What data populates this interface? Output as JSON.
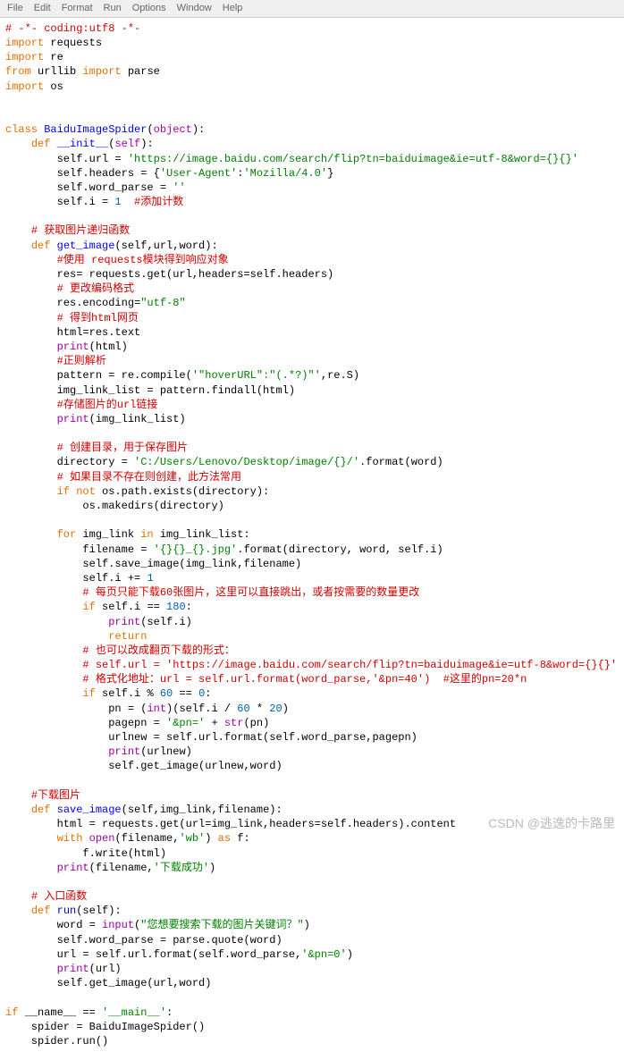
{
  "menu": [
    "File",
    "Edit",
    "Format",
    "Run",
    "Options",
    "Window",
    "Help"
  ],
  "lines": [
    [
      [
        "comment-red",
        "# -*- coding:utf8 -*-"
      ]
    ],
    [
      [
        "kw-orange",
        "import"
      ],
      [
        "txt",
        " requests"
      ]
    ],
    [
      [
        "kw-orange",
        "import"
      ],
      [
        "txt",
        " re"
      ]
    ],
    [
      [
        "kw-orange",
        "from"
      ],
      [
        "txt",
        " urllib "
      ],
      [
        "kw-orange",
        "import"
      ],
      [
        "txt",
        " parse"
      ]
    ],
    [
      [
        "kw-orange",
        "import"
      ],
      [
        "txt",
        " os"
      ]
    ],
    [
      [
        "txt",
        ""
      ]
    ],
    [
      [
        "txt",
        ""
      ]
    ],
    [
      [
        "kw-orange",
        "class"
      ],
      [
        "txt",
        " "
      ],
      [
        "kw-blue",
        "BaiduImageSpider"
      ],
      [
        "txt",
        "("
      ],
      [
        "bi-purple",
        "object"
      ],
      [
        "txt",
        "):"
      ]
    ],
    [
      [
        "txt",
        "    "
      ],
      [
        "kw-orange",
        "def"
      ],
      [
        "txt",
        " "
      ],
      [
        "kw-blue",
        "__init__"
      ],
      [
        "txt",
        "("
      ],
      [
        "bi-purple",
        "self"
      ],
      [
        "txt",
        "):"
      ]
    ],
    [
      [
        "txt",
        "        self.url = "
      ],
      [
        "str-green",
        "'https://image.baidu.com/search/flip?tn=baiduimage&ie=utf-8&word={}{}'"
      ]
    ],
    [
      [
        "txt",
        "        self.headers = {"
      ],
      [
        "str-green",
        "'User-Agent'"
      ],
      [
        "txt",
        ":"
      ],
      [
        "str-green",
        "'Mozilla/4.0'"
      ],
      [
        "txt",
        "}"
      ]
    ],
    [
      [
        "txt",
        "        self.word_parse = "
      ],
      [
        "str-green",
        "''"
      ],
      [
        "txt",
        ""
      ]
    ],
    [
      [
        "txt",
        "        self.i = "
      ],
      [
        "num",
        "1"
      ],
      [
        "txt",
        "  "
      ],
      [
        "comment-red",
        "#添加计数"
      ]
    ],
    [
      [
        "txt",
        ""
      ]
    ],
    [
      [
        "txt",
        "    "
      ],
      [
        "comment-red",
        "# 获取图片递归函数"
      ]
    ],
    [
      [
        "txt",
        "    "
      ],
      [
        "kw-orange",
        "def"
      ],
      [
        "txt",
        " "
      ],
      [
        "kw-blue",
        "get_image"
      ],
      [
        "txt",
        "(self,url,word):"
      ]
    ],
    [
      [
        "txt",
        "        "
      ],
      [
        "comment-red",
        "#使用 requests模块得到响应对象"
      ]
    ],
    [
      [
        "txt",
        "        res= requests.get(url,headers=self.headers)"
      ]
    ],
    [
      [
        "txt",
        "        "
      ],
      [
        "comment-red",
        "# 更改编码格式"
      ]
    ],
    [
      [
        "txt",
        "        res.encoding="
      ],
      [
        "str-green",
        "\"utf-8\""
      ]
    ],
    [
      [
        "txt",
        "        "
      ],
      [
        "comment-red",
        "# 得到html网页"
      ]
    ],
    [
      [
        "txt",
        "        html=res.text"
      ]
    ],
    [
      [
        "txt",
        "        "
      ],
      [
        "bi-purple",
        "print"
      ],
      [
        "txt",
        "(html)"
      ]
    ],
    [
      [
        "txt",
        "        "
      ],
      [
        "comment-red",
        "#正则解析"
      ]
    ],
    [
      [
        "txt",
        "        pattern = re.compile("
      ],
      [
        "str-green",
        "'\"hoverURL\":\"(.*?)\"'"
      ],
      [
        "txt",
        ",re.S)"
      ]
    ],
    [
      [
        "txt",
        "        img_link_list = pattern.findall(html)"
      ]
    ],
    [
      [
        "txt",
        "        "
      ],
      [
        "comment-red",
        "#存储图片的url链接"
      ]
    ],
    [
      [
        "txt",
        "        "
      ],
      [
        "bi-purple",
        "print"
      ],
      [
        "txt",
        "(img_link_list)"
      ]
    ],
    [
      [
        "txt",
        ""
      ]
    ],
    [
      [
        "txt",
        "        "
      ],
      [
        "comment-red",
        "# 创建目录，用于保存图片"
      ]
    ],
    [
      [
        "txt",
        "        directory = "
      ],
      [
        "str-green",
        "'C:/Users/Lenovo/Desktop/image/{}/'"
      ],
      [
        "txt",
        ".format(word)"
      ]
    ],
    [
      [
        "txt",
        "        "
      ],
      [
        "comment-red",
        "# 如果目录不存在则创建，此方法常用"
      ]
    ],
    [
      [
        "txt",
        "        "
      ],
      [
        "kw-orange",
        "if not"
      ],
      [
        "txt",
        " os.path.exists(directory):"
      ]
    ],
    [
      [
        "txt",
        "            os.makedirs(directory)"
      ]
    ],
    [
      [
        "txt",
        ""
      ]
    ],
    [
      [
        "txt",
        "        "
      ],
      [
        "kw-orange",
        "for"
      ],
      [
        "txt",
        " img_link "
      ],
      [
        "kw-orange",
        "in"
      ],
      [
        "txt",
        " img_link_list:"
      ]
    ],
    [
      [
        "txt",
        "            filename = "
      ],
      [
        "str-green",
        "'{}{}_{}.jpg'"
      ],
      [
        "txt",
        ".format(directory, word, self.i)"
      ]
    ],
    [
      [
        "txt",
        "            self.save_image(img_link,filename)"
      ]
    ],
    [
      [
        "txt",
        "            self.i += "
      ],
      [
        "num",
        "1"
      ]
    ],
    [
      [
        "txt",
        "            "
      ],
      [
        "comment-red",
        "# 每页只能下载60张图片，这里可以直接跳出，或者按需要的数量更改"
      ]
    ],
    [
      [
        "txt",
        "            "
      ],
      [
        "kw-orange",
        "if"
      ],
      [
        "txt",
        " self.i == "
      ],
      [
        "num",
        "180"
      ],
      [
        "txt",
        ":"
      ]
    ],
    [
      [
        "txt",
        "                "
      ],
      [
        "bi-purple",
        "print"
      ],
      [
        "txt",
        "(self.i)"
      ]
    ],
    [
      [
        "txt",
        "                "
      ],
      [
        "kw-orange",
        "return"
      ]
    ],
    [
      [
        "txt",
        "            "
      ],
      [
        "comment-red",
        "# 也可以改成翻页下载的形式："
      ]
    ],
    [
      [
        "txt",
        "            "
      ],
      [
        "comment-red",
        "# self.url = 'https://image.baidu.com/search/flip?tn=baiduimage&ie=utf-8&word={}{}'"
      ]
    ],
    [
      [
        "txt",
        "            "
      ],
      [
        "comment-red",
        "# 格式化地址：url = self.url.format(word_parse,'&pn=40')  #这里的pn=20*n"
      ]
    ],
    [
      [
        "txt",
        "            "
      ],
      [
        "kw-orange",
        "if"
      ],
      [
        "txt",
        " self.i % "
      ],
      [
        "num",
        "60"
      ],
      [
        "txt",
        " == "
      ],
      [
        "num",
        "0"
      ],
      [
        "txt",
        ":"
      ]
    ],
    [
      [
        "txt",
        "                pn = ("
      ],
      [
        "bi-purple",
        "int"
      ],
      [
        "txt",
        ")(self.i / "
      ],
      [
        "num",
        "60"
      ],
      [
        "txt",
        " * "
      ],
      [
        "num",
        "20"
      ],
      [
        "txt",
        ")"
      ]
    ],
    [
      [
        "txt",
        "                pagepn = "
      ],
      [
        "str-green",
        "'&pn='"
      ],
      [
        "txt",
        " + "
      ],
      [
        "bi-purple",
        "str"
      ],
      [
        "txt",
        "(pn)"
      ]
    ],
    [
      [
        "txt",
        "                urlnew = self.url.format(self.word_parse,pagepn)"
      ]
    ],
    [
      [
        "txt",
        "                "
      ],
      [
        "bi-purple",
        "print"
      ],
      [
        "txt",
        "(urlnew)"
      ]
    ],
    [
      [
        "txt",
        "                self.get_image(urlnew,word)"
      ]
    ],
    [
      [
        "txt",
        ""
      ]
    ],
    [
      [
        "txt",
        "    "
      ],
      [
        "comment-red",
        "#下载图片"
      ]
    ],
    [
      [
        "txt",
        "    "
      ],
      [
        "kw-orange",
        "def"
      ],
      [
        "txt",
        " "
      ],
      [
        "kw-blue",
        "save_image"
      ],
      [
        "txt",
        "(self,img_link,filename):"
      ]
    ],
    [
      [
        "txt",
        "        html = requests.get(url=img_link,headers=self.headers).content"
      ]
    ],
    [
      [
        "txt",
        "        "
      ],
      [
        "kw-orange",
        "with"
      ],
      [
        "txt",
        " "
      ],
      [
        "bi-purple",
        "open"
      ],
      [
        "txt",
        "(filename,"
      ],
      [
        "str-green",
        "'wb'"
      ],
      [
        "txt",
        ") "
      ],
      [
        "kw-orange",
        "as"
      ],
      [
        "txt",
        " f:"
      ]
    ],
    [
      [
        "txt",
        "            f.write(html)"
      ]
    ],
    [
      [
        "txt",
        "        "
      ],
      [
        "bi-purple",
        "print"
      ],
      [
        "txt",
        "(filename,"
      ],
      [
        "str-green",
        "'下载成功'"
      ],
      [
        "txt",
        ")"
      ]
    ],
    [
      [
        "txt",
        ""
      ]
    ],
    [
      [
        "txt",
        "    "
      ],
      [
        "comment-red",
        "# 入口函数"
      ]
    ],
    [
      [
        "txt",
        "    "
      ],
      [
        "kw-orange",
        "def"
      ],
      [
        "txt",
        " "
      ],
      [
        "kw-blue",
        "run"
      ],
      [
        "txt",
        "(self):"
      ]
    ],
    [
      [
        "txt",
        "        word = "
      ],
      [
        "bi-purple",
        "input"
      ],
      [
        "txt",
        "("
      ],
      [
        "str-green",
        "\"您想要搜索下载的图片关键词？\""
      ],
      [
        "txt",
        ")"
      ]
    ],
    [
      [
        "txt",
        "        self.word_parse = parse.quote(word)"
      ]
    ],
    [
      [
        "txt",
        "        url = self.url.format(self.word_parse,"
      ],
      [
        "str-green",
        "'&pn=0'"
      ],
      [
        "txt",
        ")"
      ]
    ],
    [
      [
        "txt",
        "        "
      ],
      [
        "bi-purple",
        "print"
      ],
      [
        "txt",
        "(url)"
      ]
    ],
    [
      [
        "txt",
        "        self.get_image(url,word)"
      ]
    ],
    [
      [
        "txt",
        ""
      ]
    ],
    [
      [
        "kw-orange",
        "if"
      ],
      [
        "txt",
        " __name__ == "
      ],
      [
        "str-green",
        "'__main__'"
      ],
      [
        "txt",
        ":"
      ]
    ],
    [
      [
        "txt",
        "    spider = BaiduImageSpider()"
      ]
    ],
    [
      [
        "txt",
        "    spider.run()"
      ]
    ]
  ],
  "watermark": "CSDN @逃逸的卡路里"
}
